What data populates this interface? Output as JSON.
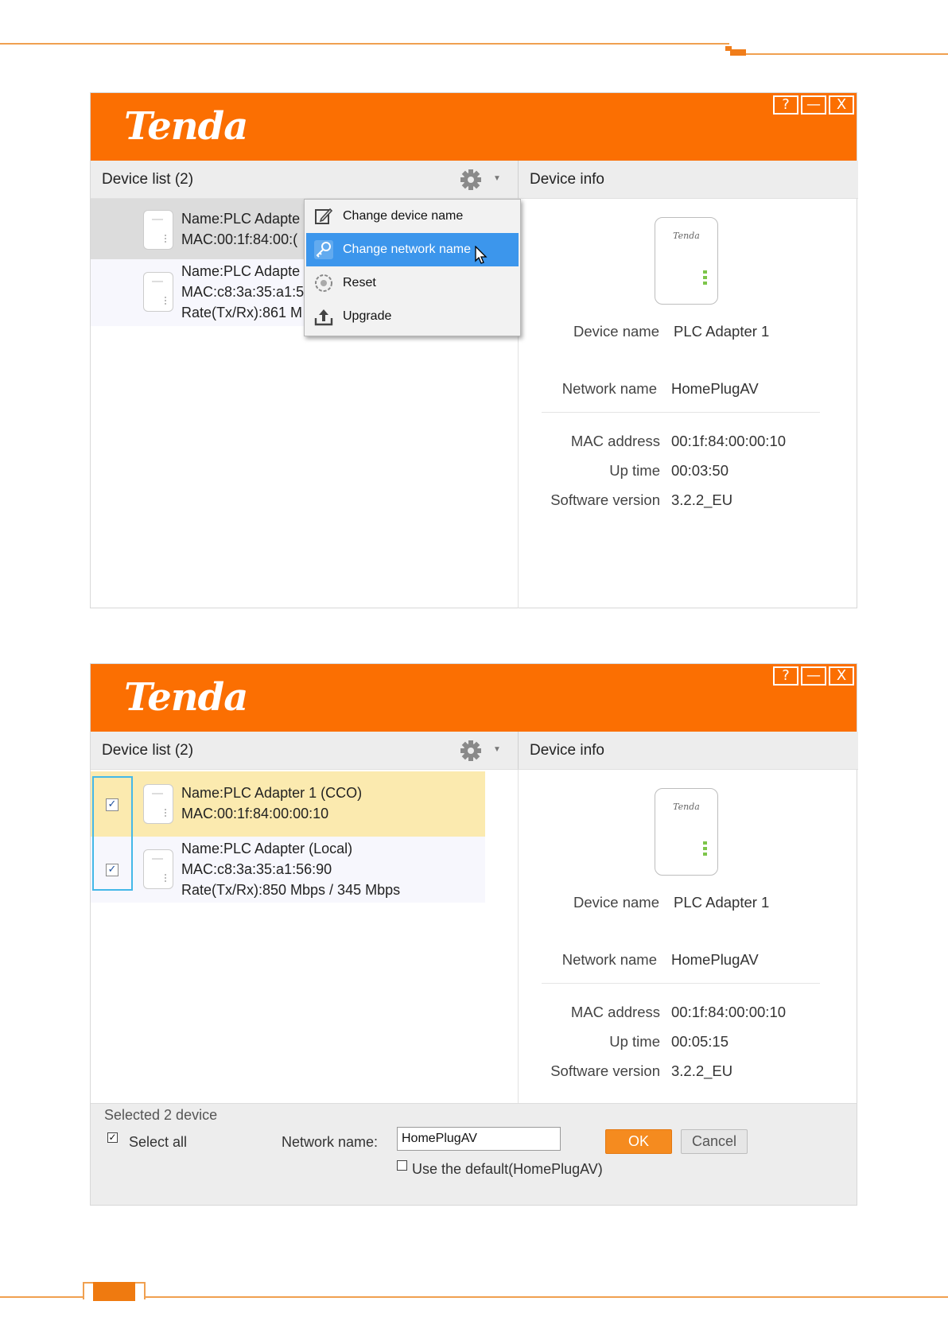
{
  "brand": "Tenda",
  "window_controls": {
    "help": "?",
    "minimize": "—",
    "close": "X"
  },
  "window1": {
    "device_list_header": "Device list (2)",
    "device_info_header": "Device info",
    "rows": [
      {
        "line1": "Name:PLC Adapte",
        "line2": "MAC:00:1f:84:00:("
      },
      {
        "line1": "Name:PLC Adapte",
        "line2": "MAC:c8:3a:35:a1:5",
        "line3": "Rate(Tx/Rx):861 M"
      }
    ],
    "menu": {
      "items": [
        {
          "label": "Change device name",
          "icon": "edit-icon"
        },
        {
          "label": "Change network name",
          "icon": "key-icon",
          "active": true
        },
        {
          "label": "Reset",
          "icon": "reset-icon"
        },
        {
          "label": "Upgrade",
          "icon": "upload-icon"
        }
      ]
    },
    "info": {
      "device_image_brand": "Tenda",
      "device_name_label": "Device name",
      "device_name": "PLC Adapter 1",
      "network_name_label": "Network name",
      "network_name": "HomePlugAV",
      "mac_label": "MAC address",
      "mac": "00:1f:84:00:00:10",
      "uptime_label": "Up time",
      "uptime": "00:03:50",
      "sw_label": "Software version",
      "sw": "3.2.2_EU"
    }
  },
  "window2": {
    "device_list_header": "Device list (2)",
    "device_info_header": "Device info",
    "rows": [
      {
        "line1": "Name:PLC Adapter 1 (CCO)",
        "line2": "MAC:00:1f:84:00:00:10",
        "checked": true
      },
      {
        "line1": "Name:PLC Adapter (Local)",
        "line2": "MAC:c8:3a:35:a1:56:90",
        "line3": "Rate(Tx/Rx):850 Mbps / 345 Mbps",
        "checked": true
      }
    ],
    "info": {
      "device_image_brand": "Tenda",
      "device_name_label": "Device name",
      "device_name": "PLC Adapter 1",
      "network_name_label": "Network name",
      "network_name": "HomePlugAV",
      "mac_label": "MAC address",
      "mac": "00:1f:84:00:00:10",
      "uptime_label": "Up time",
      "uptime": "00:05:15",
      "sw_label": "Software version",
      "sw": "3.2.2_EU"
    },
    "bottom": {
      "selected_text": "Selected 2 device",
      "select_all_label": "Select all",
      "select_all_checked": true,
      "network_name_label": "Network name:",
      "network_name_value": "HomePlugAV",
      "use_default_label": "Use the default(HomePlugAV)",
      "use_default_checked": false,
      "ok_label": "OK",
      "cancel_label": "Cancel"
    }
  },
  "colors": {
    "brand_orange": "#fb6f02",
    "menu_highlight": "#3c96ec",
    "selected_row_yellow": "#fbeaaf",
    "checkbox_frame": "#44b8e8",
    "ok_button": "#f58b1f"
  }
}
